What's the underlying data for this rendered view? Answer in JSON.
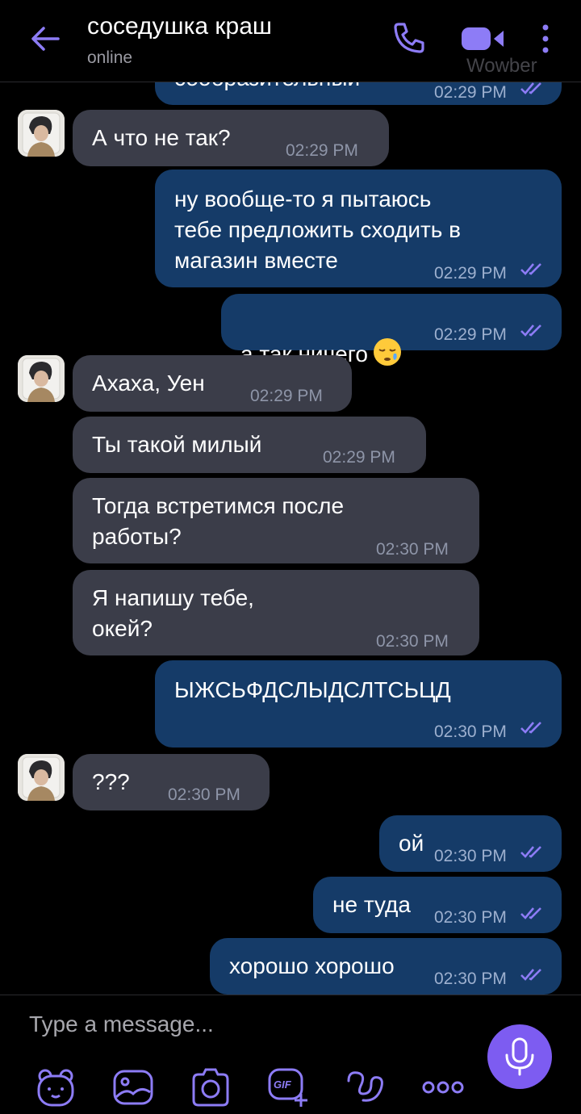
{
  "header": {
    "title": "соседушка краш",
    "status": "online",
    "watermark": "Wowber"
  },
  "messages": [
    {
      "dir": "out",
      "text": "сообразительный",
      "time": "02:29 PM",
      "read": true,
      "partial": true
    },
    {
      "dir": "in",
      "text": "А что не так?",
      "time": "02:29 PM",
      "avatar": true
    },
    {
      "dir": "out",
      "text": "ну вообще-то я пытаюсь\nтебе предложить сходить в\nмагазин вместе",
      "time": "02:29 PM",
      "read": true
    },
    {
      "dir": "out",
      "text": "а так ничего",
      "emoji": "sleepy-face-emoji",
      "time": "02:29 PM",
      "read": true
    },
    {
      "dir": "in",
      "text": "Ахаха, Уен",
      "time": "02:29 PM",
      "avatar": true
    },
    {
      "dir": "in",
      "text": "Ты такой милый",
      "time": "02:29 PM"
    },
    {
      "dir": "in",
      "text": "Тогда встретимся после\nработы?",
      "time": "02:30 PM"
    },
    {
      "dir": "in",
      "text": "Я напишу тебе,\nокей?",
      "time": "02:30 PM"
    },
    {
      "dir": "out",
      "text": "ЫЖСЬФДСЛЫДСЛТСЬЦД",
      "time": "02:30 PM",
      "read": true
    },
    {
      "dir": "in",
      "text": "???",
      "time": "02:30 PM",
      "avatar": true
    },
    {
      "dir": "out",
      "text": "ой",
      "time": "02:30 PM",
      "read": true
    },
    {
      "dir": "out",
      "text": "не туда",
      "time": "02:30 PM",
      "read": true
    },
    {
      "dir": "out",
      "text": "хорошо хорошо",
      "time": "02:30 PM",
      "read": true
    }
  ],
  "composer": {
    "placeholder": "Type a message...",
    "tools": [
      "sticker-icon",
      "image-icon",
      "camera-icon",
      "gif-icon",
      "doodle-icon",
      "more-icon"
    ],
    "send_icon": "microphone-icon"
  },
  "colors": {
    "incoming_bubble": "#3b3d49",
    "outgoing_bubble": "#153b68",
    "accent": "#7d5cf1"
  }
}
